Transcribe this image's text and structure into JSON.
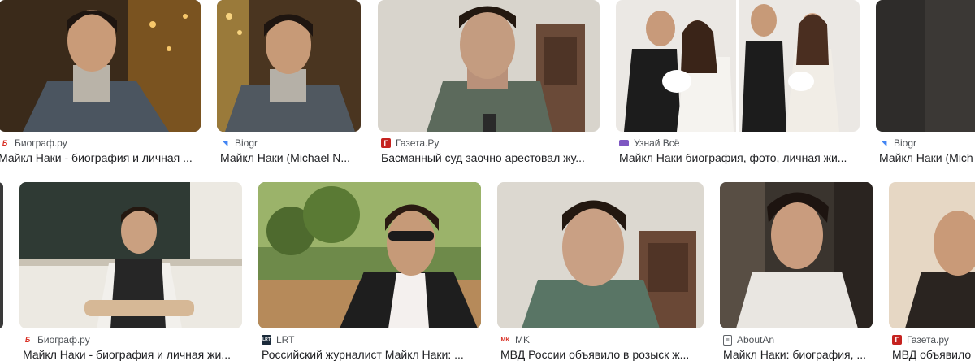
{
  "results": [
    {
      "source": "Биограф.ру",
      "title": "Майкл Наки - биография и личная ...",
      "favicon": "biograf-icon"
    },
    {
      "source": "Biogr",
      "title": "Майкл Наки (Michael N...",
      "favicon": "biogr-icon"
    },
    {
      "source": "Газета.Ру",
      "title": "Басманный суд заочно арестовал жу...",
      "favicon": "gazeta-icon"
    },
    {
      "source": "Узнай Всё",
      "title": "Майкл Наки биография, фото, личная жи...",
      "favicon": "uznay-icon"
    },
    {
      "source": "Biogr",
      "title": "Майкл Наки (Mich",
      "favicon": "biogr-icon"
    },
    {
      "source": "Биограф.ру",
      "title": "Майкл Наки - биография и личная жи...",
      "favicon": "biograf-icon"
    },
    {
      "source": "LRT",
      "title": "Российский журналист Майкл Наки: ...",
      "favicon": "lrt-icon"
    },
    {
      "source": "MK",
      "title": "МВД России объявило в розыск ж...",
      "favicon": "mk-icon"
    },
    {
      "source": "AboutAn",
      "title": "Майкл Наки: биография, ...",
      "favicon": "aboutan-icon"
    },
    {
      "source": "Газета.ру",
      "title": "МВД объявило",
      "favicon": "gazeta-icon"
    }
  ],
  "colors": {
    "source_text": "#4d5156",
    "title_text": "#202124",
    "biograf_red": "#d93025",
    "gazeta_red": "#c5221f",
    "uznay_purple": "#7e57c2",
    "biogr_blue": "#4285f4"
  }
}
